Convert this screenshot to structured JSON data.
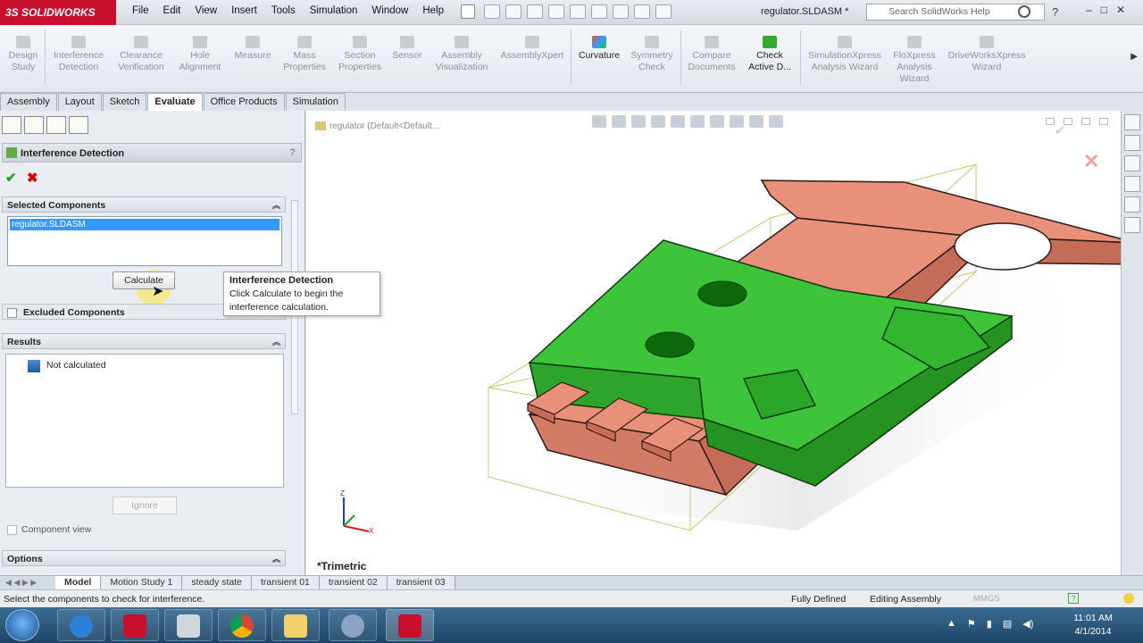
{
  "titlebar": {
    "logo": "3S SOLIDWORKS",
    "menus": [
      "File",
      "Edit",
      "View",
      "Insert",
      "Tools",
      "Simulation",
      "Window",
      "Help"
    ],
    "doc_name": "regulator.SLDASM *",
    "search_placeholder": "Search SolidWorks Help"
  },
  "ribbon": {
    "buttons": [
      {
        "label": "Design Study",
        "icon": "design-study-icon"
      },
      {
        "label": "Interference Detection",
        "icon": "interference-icon"
      },
      {
        "label": "Clearance Verification",
        "icon": "clearance-icon"
      },
      {
        "label": "Hole Alignment",
        "icon": "hole-icon"
      },
      {
        "label": "Measure",
        "icon": "measure-icon"
      },
      {
        "label": "Mass Properties",
        "icon": "mass-icon"
      },
      {
        "label": "Section Properties",
        "icon": "section-icon"
      },
      {
        "label": "Sensor",
        "icon": "sensor-icon"
      },
      {
        "label": "Assembly Visualization",
        "icon": "visualization-icon"
      },
      {
        "label": "AssemblyXpert",
        "icon": "xpert-icon"
      },
      {
        "label": "Curvature",
        "icon": "curvature-icon"
      },
      {
        "label": "Symmetry Check",
        "icon": "symmetry-icon"
      },
      {
        "label": "Compare Documents",
        "icon": "compare-icon"
      },
      {
        "label": "Check Active D...",
        "icon": "check-icon"
      },
      {
        "label": "SimulationXpress Analysis Wizard",
        "icon": "simxpress-icon"
      },
      {
        "label": "FloXpress Analysis Wizard",
        "icon": "floxpress-icon"
      },
      {
        "label": "DriveWorksXpress Wizard",
        "icon": "driveworks-icon"
      }
    ]
  },
  "tabs": [
    "Assembly",
    "Layout",
    "Sketch",
    "Evaluate",
    "Office Products",
    "Simulation"
  ],
  "active_tab": "Evaluate",
  "property_manager": {
    "title": "Interference Detection",
    "selected_components_header": "Selected Components",
    "selected_item": "regulator.SLDASM",
    "calculate_label": "Calculate",
    "excluded_components_label": "Excluded Components",
    "results_header": "Results",
    "results_text": "Not calculated",
    "ignore_label": "Ignore",
    "component_view_label": "Component view",
    "options_header": "Options",
    "help_glyph": "?"
  },
  "tooltip": {
    "title": "Interference Detection",
    "body": "Click Calculate to begin the interference calculation."
  },
  "viewport": {
    "tree_root": "regulator  (Default<Default...",
    "view_label": "*Trimetric",
    "part_colors": {
      "green": "#3ec43b",
      "salmon": "#e9907a"
    }
  },
  "bottom_tabs": [
    "Model",
    "Motion Study 1",
    "steady state",
    "transient 01",
    "transient 02",
    "transient 03"
  ],
  "status": {
    "message": "Select the components to check for interference.",
    "definition": "Fully Defined",
    "mode": "Editing Assembly",
    "units": "MMGS"
  },
  "clock": {
    "time": "11:01 AM",
    "date": "4/1/2014"
  }
}
